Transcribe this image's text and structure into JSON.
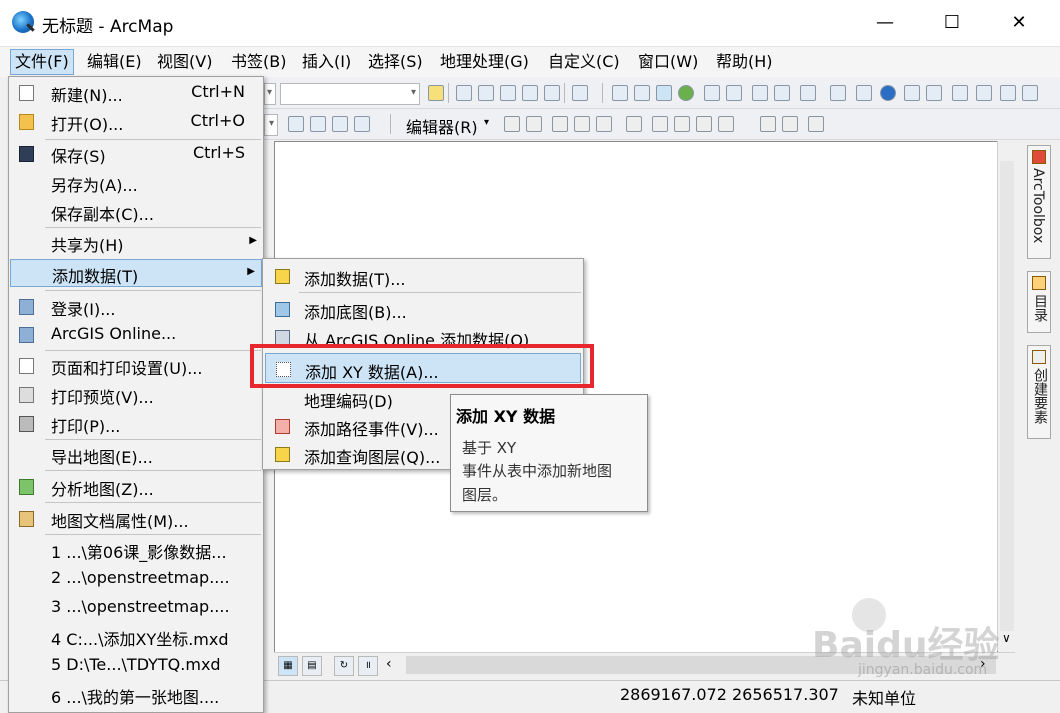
{
  "window": {
    "title": "无标题 - ArcMap",
    "minimize": "—",
    "maximize": "☐",
    "close": "✕"
  },
  "menubar": [
    "文件(F)",
    "编辑(E)",
    "视图(V)",
    "书签(B)",
    "插入(I)",
    "选择(S)",
    "地理处理(G)",
    "自定义(C)",
    "窗口(W)",
    "帮助(H)"
  ],
  "toolbar": {
    "editor_label": "编辑器(R)"
  },
  "file_menu": {
    "items": [
      {
        "label": "新建(N)...",
        "shortcut": "Ctrl+N"
      },
      {
        "label": "打开(O)...",
        "shortcut": "Ctrl+O"
      },
      {
        "label": "保存(S)",
        "shortcut": "Ctrl+S"
      },
      {
        "label": "另存为(A)..."
      },
      {
        "label": "保存副本(C)..."
      },
      {
        "label": "共享为(H)"
      },
      {
        "label": "添加数据(T)"
      },
      {
        "label": "登录(I)..."
      },
      {
        "label": "ArcGIS Online..."
      },
      {
        "label": "页面和打印设置(U)..."
      },
      {
        "label": "打印预览(V)..."
      },
      {
        "label": "打印(P)..."
      },
      {
        "label": "导出地图(E)..."
      },
      {
        "label": "分析地图(Z)..."
      },
      {
        "label": "地图文档属性(M)..."
      },
      {
        "label": "1 ...\\第06课_影像数据..."
      },
      {
        "label": "2 ...\\openstreetmap...."
      },
      {
        "label": "3 ...\\openstreetmap...."
      },
      {
        "label": "4 C:...\\添加XY坐标.mxd"
      },
      {
        "label": "5 D:\\Te...\\TDYTQ.mxd"
      },
      {
        "label": "6 ...\\我的第一张地图...."
      }
    ]
  },
  "add_data_submenu": {
    "items": [
      {
        "label": "添加数据(T)..."
      },
      {
        "label": "添加底图(B)..."
      },
      {
        "label": "从 ArcGIS Online 添加数据(O)..."
      },
      {
        "label": "添加 XY 数据(A)..."
      },
      {
        "label": "地理编码(D)"
      },
      {
        "label": "添加路径事件(V)..."
      },
      {
        "label": "添加查询图层(Q)..."
      }
    ]
  },
  "tooltip": {
    "title": "添加 XY 数据",
    "line1": "基于 XY",
    "line2": "事件从表中添加新地图",
    "line3": "图层。"
  },
  "right_dock": [
    "ArcToolbox",
    "目录",
    "创建要素"
  ],
  "statusbar": {
    "coords": "2869167.072  2656517.307",
    "units": "未知单位"
  },
  "watermark": {
    "brand": "Baidu经验",
    "url": "jingyan.baidu.com"
  },
  "colors": {
    "highlight": "#cde4f7",
    "highlight_border": "#7aa7d4",
    "red_box": "#e8262d"
  }
}
